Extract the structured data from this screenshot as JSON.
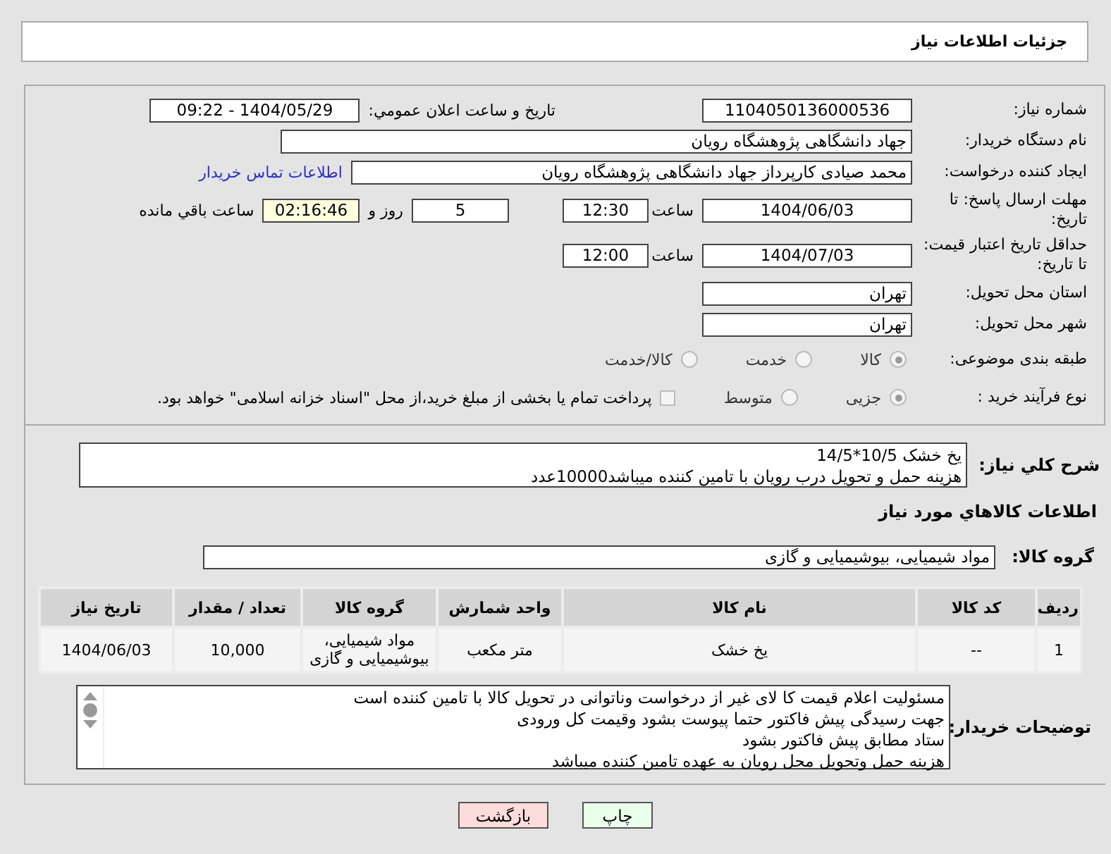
{
  "header": {
    "title": "جزئیات اطلاعات نیاز"
  },
  "need_number": {
    "label": "شماره نیاز:",
    "value": "1104050136000536"
  },
  "announce": {
    "label": "تاریخ و ساعت اعلان عمومي:",
    "value": "1404/05/29 - 09:22"
  },
  "buyer_org": {
    "label": "نام دستگاه خریدار:",
    "value": "جهاد دانشگاهی پژوهشگاه رویان"
  },
  "requester": {
    "label": "ایجاد کننده درخواست:",
    "value": "محمد صیادی کارپرداز جهاد دانشگاهی پژوهشگاه رویان",
    "link": "اطلاعات تماس خریدار"
  },
  "reply_deadline": {
    "label": "مهلت ارسال پاسخ: تا تاریخ:",
    "date": "1404/06/03",
    "time_label": "ساعت",
    "time": "12:30",
    "days": "5",
    "days_label": "روز و",
    "remaining": "02:16:46",
    "remaining_label": "ساعت باقي مانده"
  },
  "price_validity": {
    "label": "حداقل تاریخ اعتبار قیمت: تا تاریخ:",
    "date": "1404/07/03",
    "time_label": "ساعت",
    "time": "12:00"
  },
  "province": {
    "label": "استان محل تحویل:",
    "value": "تهران"
  },
  "city": {
    "label": "شهر محل تحویل:",
    "value": "تهران"
  },
  "category": {
    "label": "طبقه بندی موضوعی:",
    "options": [
      {
        "label": "کالا",
        "selected": true
      },
      {
        "label": "خدمت",
        "selected": false
      },
      {
        "label": "کالا/خدمت",
        "selected": false
      }
    ]
  },
  "process": {
    "label": "نوع فرآیند خرید :",
    "options": [
      {
        "label": "جزیی",
        "selected": true
      },
      {
        "label": "متوسط",
        "selected": false
      }
    ],
    "treasury": {
      "label": "پرداخت تمام یا بخشی از مبلغ خرید،از محل \"اسناد خزانه اسلامی\" خواهد بود.",
      "checked": false
    }
  },
  "description": {
    "label": "شرح کلي نياز:",
    "lines": [
      "یخ خشک 10/5*14/5",
      "هزینه حمل و تحویل درب رویان با تامین کننده میباشد10000عدد"
    ]
  },
  "goods": {
    "title": "اطلاعات کالاهاي مورد نياز",
    "group_label": "گروه کالا:",
    "group": "مواد شیمیایی، بیوشیمیایی و  گازی"
  },
  "table": {
    "columns": [
      "ردیف",
      "کد کالا",
      "نام کالا",
      "واحد شمارش",
      "گروه کالا",
      "تعداد / مقدار",
      "تاریخ نیاز"
    ],
    "rows": [
      [
        "1",
        "--",
        "یخ خشک",
        "متر مکعب",
        "مواد شیمیایی، بیوشیمیایی و گازی",
        "10,000",
        "1404/06/03"
      ]
    ]
  },
  "buyer_notes": {
    "label": "توضیحات خریدار:",
    "lines": [
      "مسئولیت اعلام قیمت کا لای  غیر از درخواست وناتوانی در تحویل کالا با تامین کننده است",
      "جهت رسیدگی پیش فاکتور حتما پیوست بشود وقیمت کل ورودی",
      "ستاد مطابق پیش فاکتور بشود",
      "هزینه حمل وتحویل محل رویان به عهده تامین کننده میباشد"
    ]
  },
  "buttons": [
    {
      "label": "چاپ",
      "kind": "print"
    },
    {
      "label": "بازگشت",
      "kind": "back"
    }
  ]
}
